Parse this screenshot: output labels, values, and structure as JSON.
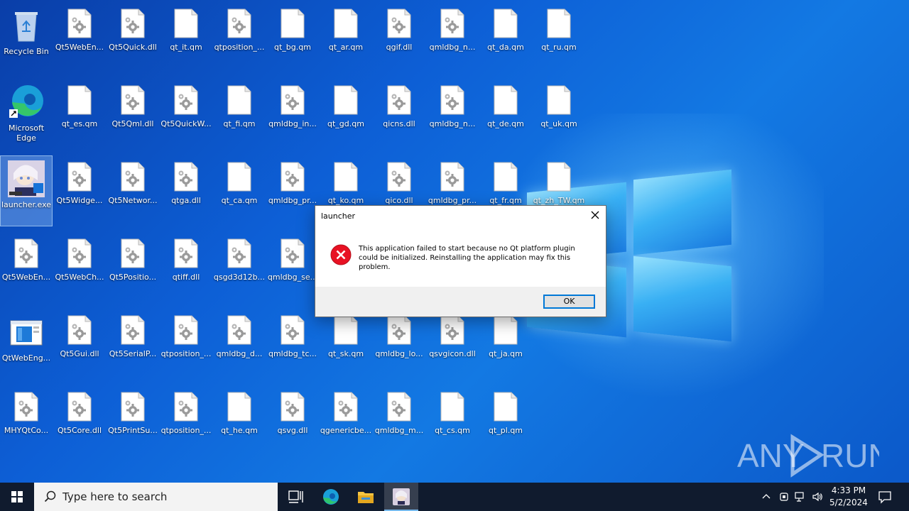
{
  "desktop": {
    "icons": [
      {
        "label": "Recycle Bin",
        "type": "recycle"
      },
      {
        "label": "Qt5WebEn...",
        "type": "dll"
      },
      {
        "label": "Qt5Quick.dll",
        "type": "dll"
      },
      {
        "label": "qt_it.qm",
        "type": "file"
      },
      {
        "label": "qtposition_...",
        "type": "dll"
      },
      {
        "label": "qt_bg.qm",
        "type": "file"
      },
      {
        "label": "qt_ar.qm",
        "type": "file"
      },
      {
        "label": "qgif.dll",
        "type": "dll"
      },
      {
        "label": "qmldbg_n...",
        "type": "dll"
      },
      {
        "label": "qt_da.qm",
        "type": "file"
      },
      {
        "label": "qt_ru.qm",
        "type": "file"
      },
      {
        "label": "Microsoft Edge",
        "type": "edge"
      },
      {
        "label": "qt_es.qm",
        "type": "file"
      },
      {
        "label": "Qt5Qml.dll",
        "type": "dll"
      },
      {
        "label": "Qt5QuickW...",
        "type": "dll"
      },
      {
        "label": "qt_fi.qm",
        "type": "file"
      },
      {
        "label": "qmldbg_in...",
        "type": "dll"
      },
      {
        "label": "qt_gd.qm",
        "type": "file"
      },
      {
        "label": "qicns.dll",
        "type": "dll"
      },
      {
        "label": "qmldbg_n...",
        "type": "dll"
      },
      {
        "label": "qt_de.qm",
        "type": "file"
      },
      {
        "label": "qt_uk.qm",
        "type": "file"
      },
      {
        "label": "launcher.exe",
        "type": "launcher"
      },
      {
        "label": "Qt5Widge...",
        "type": "dll"
      },
      {
        "label": "Qt5Networ...",
        "type": "dll"
      },
      {
        "label": "qtga.dll",
        "type": "dll"
      },
      {
        "label": "qt_ca.qm",
        "type": "file"
      },
      {
        "label": "qmldbg_pr...",
        "type": "dll"
      },
      {
        "label": "qt_ko.qm",
        "type": "file"
      },
      {
        "label": "qico.dll",
        "type": "dll"
      },
      {
        "label": "qmldbg_pr...",
        "type": "dll"
      },
      {
        "label": "qt_fr.qm",
        "type": "file"
      },
      {
        "label": "qt_zh_TW.qm",
        "type": "file"
      },
      {
        "label": "Qt5WebEn...",
        "type": "dll"
      },
      {
        "label": "Qt5WebCh...",
        "type": "dll"
      },
      {
        "label": "Qt5Positio...",
        "type": "dll"
      },
      {
        "label": "qtiff.dll",
        "type": "dll"
      },
      {
        "label": "qsgd3d12b...",
        "type": "dll"
      },
      {
        "label": "qmldbg_se...",
        "type": "dll"
      },
      {
        "label": "QtWebEng...",
        "type": "app"
      },
      {
        "label": "Qt5Gui.dll",
        "type": "dll"
      },
      {
        "label": "Qt5SerialP...",
        "type": "dll"
      },
      {
        "label": "qtposition_...",
        "type": "dll"
      },
      {
        "label": "qmldbg_d...",
        "type": "dll"
      },
      {
        "label": "qmldbg_tc...",
        "type": "dll"
      },
      {
        "label": "qt_sk.qm",
        "type": "file"
      },
      {
        "label": "qmldbg_lo...",
        "type": "dll"
      },
      {
        "label": "qsvgicon.dll",
        "type": "dll"
      },
      {
        "label": "qt_ja.qm",
        "type": "file"
      },
      {
        "label": "MHYQtCo...",
        "type": "dll"
      },
      {
        "label": "Qt5Core.dll",
        "type": "dll"
      },
      {
        "label": "Qt5PrintSu...",
        "type": "dll"
      },
      {
        "label": "qtposition_...",
        "type": "dll"
      },
      {
        "label": "qt_he.qm",
        "type": "file"
      },
      {
        "label": "qsvg.dll",
        "type": "dll"
      },
      {
        "label": "qgenericbe...",
        "type": "dll"
      },
      {
        "label": "qmldbg_m...",
        "type": "dll"
      },
      {
        "label": "qt_cs.qm",
        "type": "file"
      },
      {
        "label": "qt_pl.qm",
        "type": "file"
      }
    ]
  },
  "dialog": {
    "title": "launcher",
    "message": "This application failed to start because no Qt platform plugin could be initialized. Reinstalling the application may fix this problem.",
    "ok_label": "OK",
    "icon": "error-icon"
  },
  "taskbar": {
    "search_placeholder": "Type here to search",
    "time": "4:33 PM",
    "date": "5/2/2024",
    "icons": [
      "start-icon",
      "task-view-icon",
      "edge-icon",
      "file-explorer-icon",
      "launcher-icon"
    ]
  },
  "watermark": "ANY RUN"
}
